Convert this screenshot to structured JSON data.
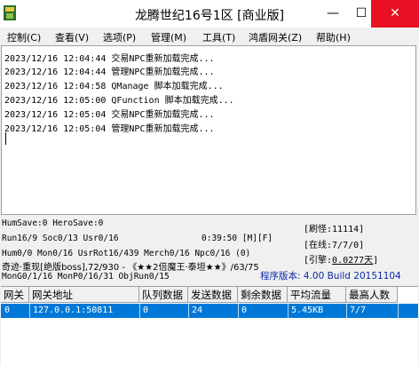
{
  "window": {
    "title": "龙腾世纪16号1区 [商业版]",
    "minimize_glyph": "—",
    "maximize_glyph": "☐",
    "close_glyph": "✕",
    "icon": "app-icon"
  },
  "menu": [
    {
      "label": "控制(C)"
    },
    {
      "label": "查看(V)"
    },
    {
      "label": "选项(P)"
    },
    {
      "label": "管理(M)"
    },
    {
      "label": "工具(T)"
    },
    {
      "label": "鸿盾网关(Z)"
    },
    {
      "label": "帮助(H)"
    }
  ],
  "log": [
    "2023/12/16 12:04:44 交易NPC重新加载完成...",
    "2023/12/16 12:04:44 管理NPC重新加载完成...",
    "2023/12/16 12:04:58 QManage 脚本加载完成...",
    "2023/12/16 12:05:00 QFunction 脚本加载完成...",
    "2023/12/16 12:05:04 交易NPC重新加载完成...",
    "2023/12/16 12:05:04 管理NPC重新加载完成..."
  ],
  "status": {
    "line1": "HumSave:0 HeroSave:0",
    "line2": "Run16/9 Soc0/13 Usr0/16",
    "clock": "0:39:50 [M][F]",
    "line3": "Hum0/0 Mon0/16 UsrRot16/439 Merch0/16 Npc0/16 (0)",
    "line4": "奇迹·重现[绝版boss],72/930 - 《★★2倍魔王·泰坦★★》/63/75",
    "line5": "MonG0/1/16 MonP0/16/31 ObjRun0/15",
    "brush": "[刷怪:11114]",
    "online": "[在线:7/7/0]",
    "gc_prefix": "[引擎:",
    "gc_value": "0.0277天",
    "gc_suffix": "]",
    "version": "程序版本: 4.00 Build 20151104"
  },
  "grid": {
    "headers": [
      "网关",
      "网关地址",
      "队列数据",
      "发送数据",
      "剩余数据",
      "平均流量",
      "最高人数"
    ],
    "rows": [
      [
        "0",
        "127.0.0.1:50811",
        "0",
        "24",
        "0",
        "5.45KB",
        "7/7"
      ]
    ],
    "selected_color": "#0078d7"
  }
}
